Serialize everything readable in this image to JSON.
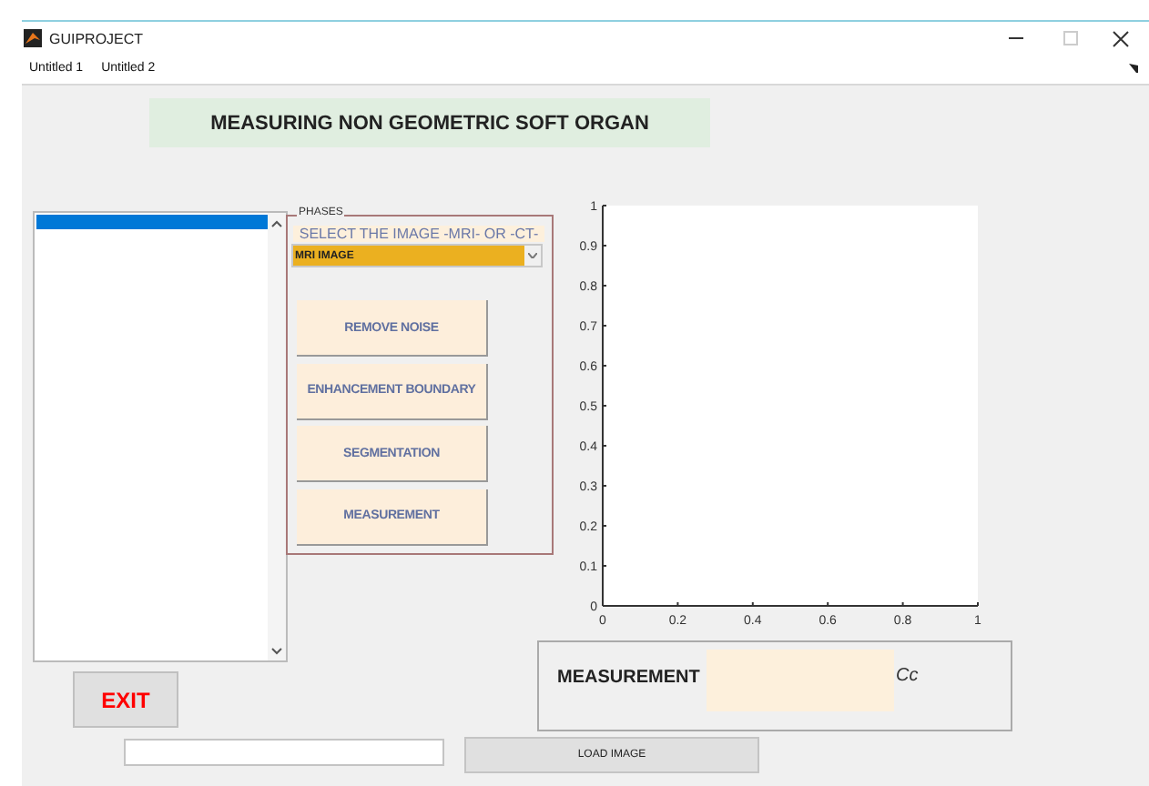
{
  "window": {
    "title": "GUIPROJECT"
  },
  "menu": [
    {
      "label": "Untitled 1"
    },
    {
      "label": "Untitled 2"
    }
  ],
  "heading": "MEASURING NON GEOMETRIC SOFT ORGAN",
  "listbox": {
    "items": [
      {
        "selected": true
      }
    ]
  },
  "phases_panel": {
    "title": "PHASES",
    "prompt": "SELECT THE IMAGE -MRI- OR -CT-",
    "dropdown": {
      "value": "MRI IMAGE"
    },
    "buttons": [
      {
        "label": "REMOVE NOISE"
      },
      {
        "label": "ENHANCEMENT BOUNDARY"
      },
      {
        "label": "SEGMENTATION"
      },
      {
        "label": "MEASUREMENT"
      }
    ]
  },
  "axes": {
    "chart_data": {
      "type": "line",
      "xlim": [
        0,
        1
      ],
      "ylim": [
        0,
        1
      ],
      "xticks": [
        0,
        0.2,
        0.4,
        0.6,
        0.8,
        1
      ],
      "yticks": [
        0,
        0.1,
        0.2,
        0.3,
        0.4,
        0.5,
        0.6,
        0.7,
        0.8,
        0.9,
        1
      ]
    }
  },
  "measurement_panel": {
    "label": "MEASUREMENT",
    "unit": "Cc"
  },
  "exit_button": "EXIT",
  "load_button": "LOAD IMAGE"
}
